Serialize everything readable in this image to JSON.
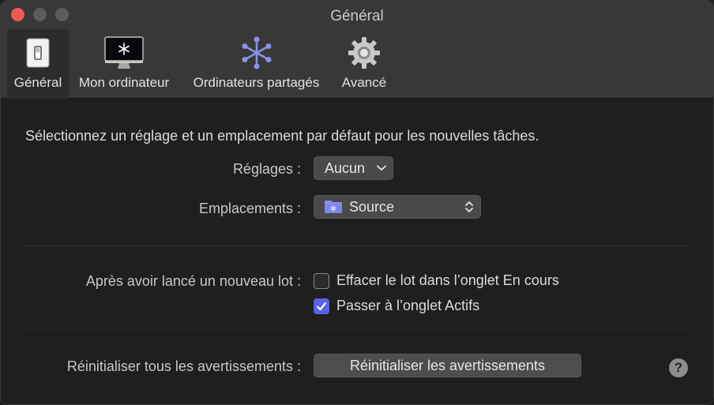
{
  "window": {
    "title": "Général"
  },
  "toolbar": {
    "tabs": [
      {
        "label": "Général",
        "icon": "switch-icon",
        "active": true
      },
      {
        "label": "Mon ordinateur",
        "icon": "imac-icon",
        "active": false
      },
      {
        "label": "Ordinateurs partagés",
        "icon": "shared-computers-icon",
        "active": false
      },
      {
        "label": "Avancé",
        "icon": "gear-icon",
        "active": false
      }
    ]
  },
  "general": {
    "intro": "Sélectionnez un réglage et un emplacement par défaut pour les nouvelles tâches.",
    "settings_label": "Réglages :",
    "settings_value": "Aucun",
    "locations_label": "Emplacements :",
    "locations_value": "Source",
    "after_batch_label": "Après avoir lancé un nouveau lot :",
    "options": [
      {
        "label": "Effacer le lot dans l’onglet En cours",
        "checked": false
      },
      {
        "label": "Passer à l’onglet Actifs",
        "checked": true
      }
    ],
    "reset_label": "Réinitialiser tous les avertissements :",
    "reset_button": "Réinitialiser les avertissements",
    "help": "?"
  },
  "colors": {
    "accent": "#5a62e6",
    "close": "#ee5a52",
    "background": "#1f1f1f",
    "toolbar": "#383838"
  }
}
